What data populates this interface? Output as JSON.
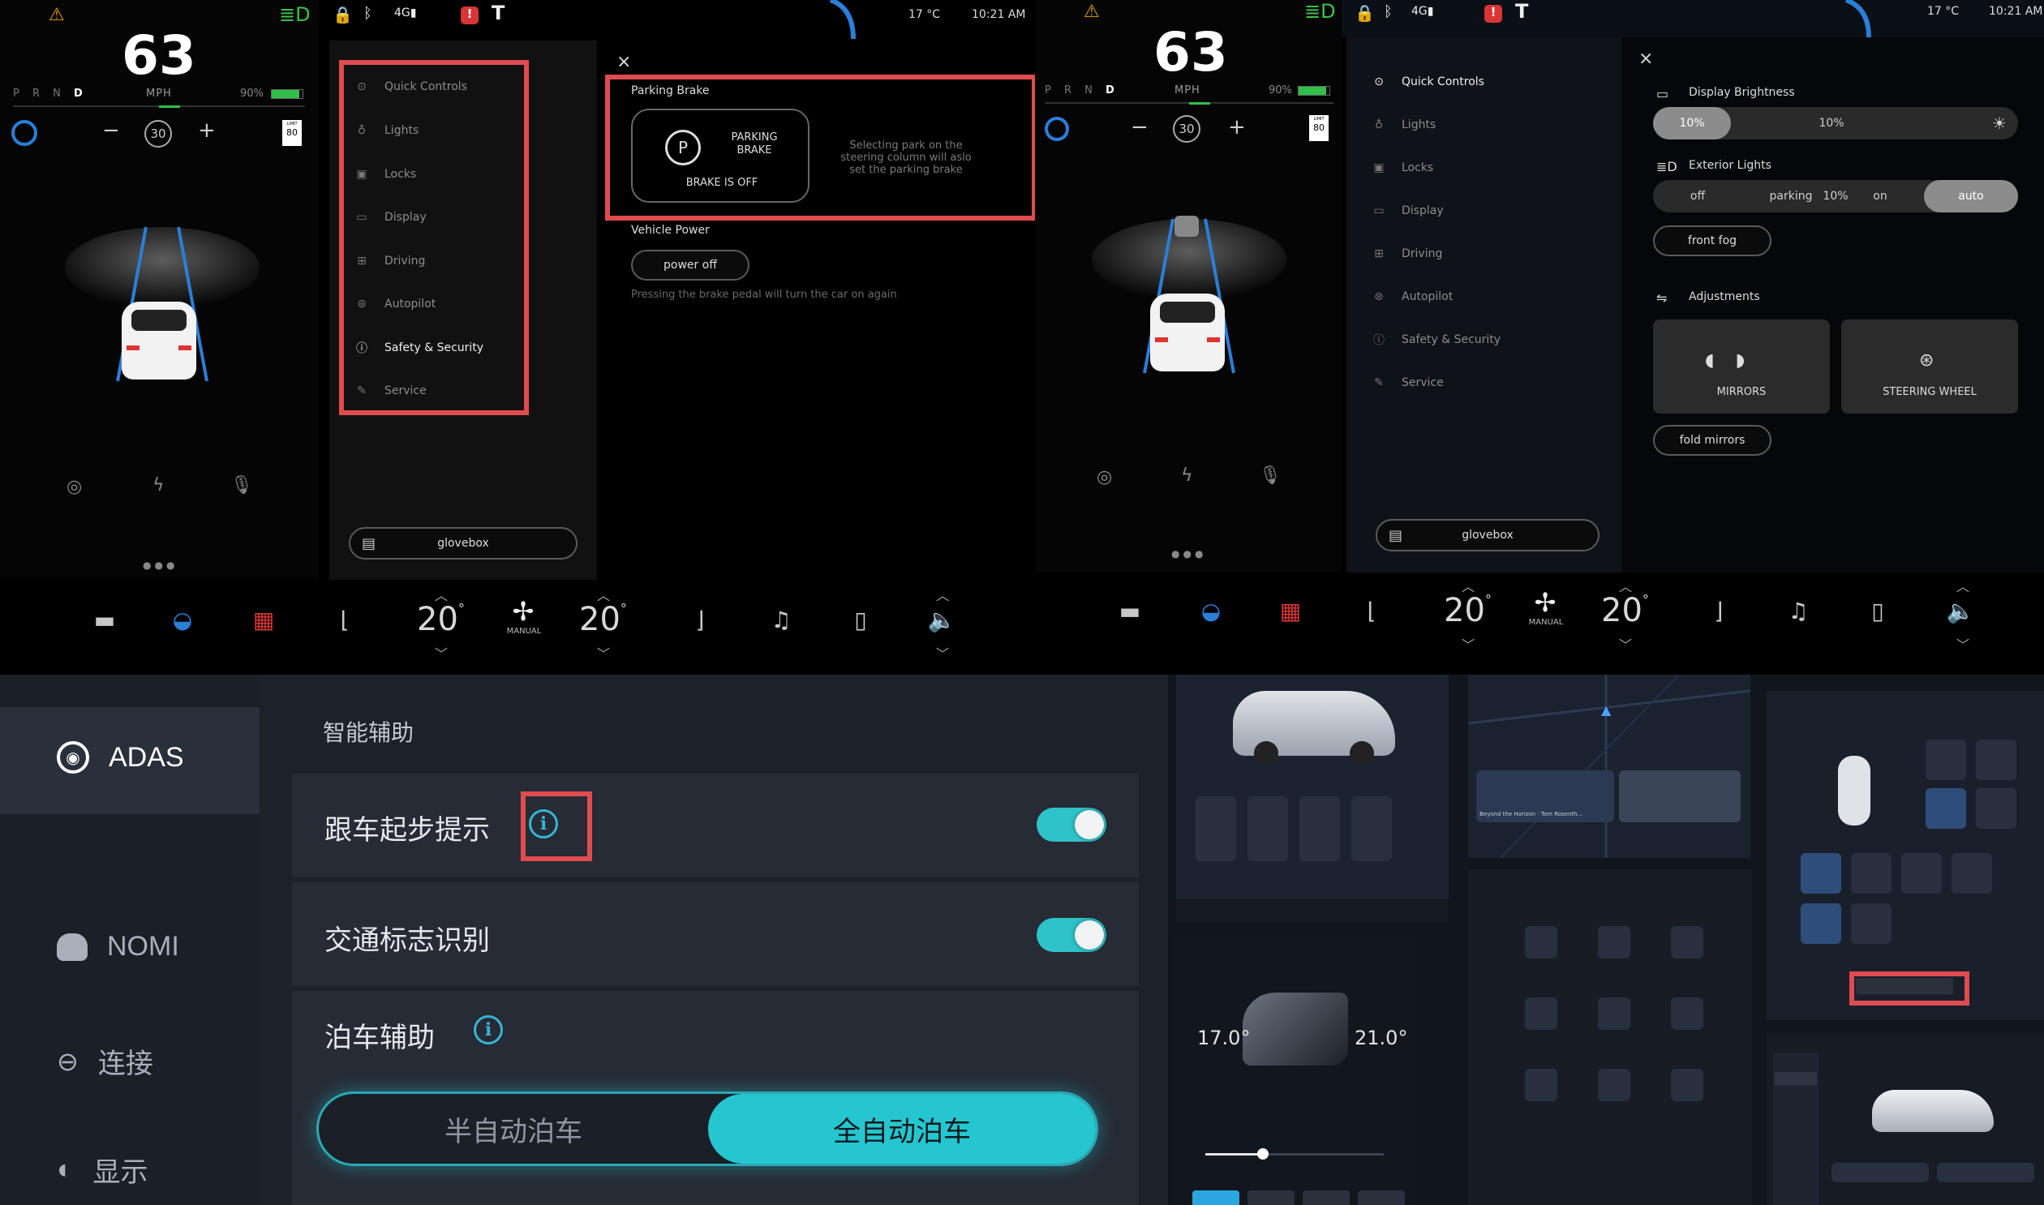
{
  "left_cluster": {
    "speed": "63",
    "speed_unit": "MPH",
    "gear": "P R N D",
    "battery": "90%",
    "cruise_speed": "30",
    "speed_limit_label": "LIMIT",
    "speed_limit": "80",
    "minus": "−",
    "plus": "+"
  },
  "status_bar": {
    "temperature": "17 °C",
    "time": "10:21 AM"
  },
  "menu": {
    "items": [
      {
        "label": "Quick Controls"
      },
      {
        "label": "Lights"
      },
      {
        "label": "Locks"
      },
      {
        "label": "Display"
      },
      {
        "label": "Driving"
      },
      {
        "label": "Autopilot"
      },
      {
        "label": "Safety & Security"
      },
      {
        "label": "Service"
      }
    ],
    "glovebox": "glovebox"
  },
  "safety_panel": {
    "close": "×",
    "parking_brake_title": "Parking Brake",
    "parking_brake_button_line1": "PARKING",
    "parking_brake_button_line2": "BRAKE",
    "parking_brake_status": "BRAKE IS OFF",
    "parking_brake_hint": "Selecting park on the steering column will aslo set the parking brake",
    "vehicle_power_title": "Vehicle Power",
    "power_off": "power off",
    "power_hint": "Pressing the brake pedal will turn the car on again"
  },
  "quick_controls_panel": {
    "close": "×",
    "display_brightness_title": "Display Brightness",
    "brightness_value": "10%",
    "brightness_value2": "10%",
    "exterior_lights_title": "Exterior Lights",
    "exterior_options": [
      "off",
      "parking",
      "10%",
      "on",
      "auto"
    ],
    "exterior_selected": "auto",
    "front_fog": "front fog",
    "adjustments_title": "Adjustments",
    "mirrors": "MIRRORS",
    "steering_wheel": "STEERING WHEEL",
    "fold_mirrors": "fold mirrors"
  },
  "climate_bar": {
    "left_temp": "20",
    "right_temp": "20",
    "temp_unit": "°",
    "fan_label": "MANUAL"
  },
  "nio": {
    "sidebar": [
      {
        "label": "ADAS"
      },
      {
        "label": "NOMI"
      },
      {
        "label": "连接"
      },
      {
        "label": "显示"
      }
    ],
    "section_title": "智能辅助",
    "rows": [
      {
        "label": "跟车起步提示"
      },
      {
        "label": "交通标志识别"
      },
      {
        "label": "泊车辅助"
      }
    ],
    "info_glyph": "i",
    "parking_options": [
      "半自动泊车",
      "全自动泊车"
    ],
    "parking_selected": "全自动泊车"
  },
  "thumbnails": {
    "climate_left_temp": "17.0°",
    "climate_right_temp": "21.0°",
    "media_text": "Beyond the Horizon · Tom Rosenth..."
  },
  "colors": {
    "highlight_red": "#e04b4f",
    "nio_accent": "#2ec3c9",
    "tesla_blue": "#2a7fd8"
  }
}
